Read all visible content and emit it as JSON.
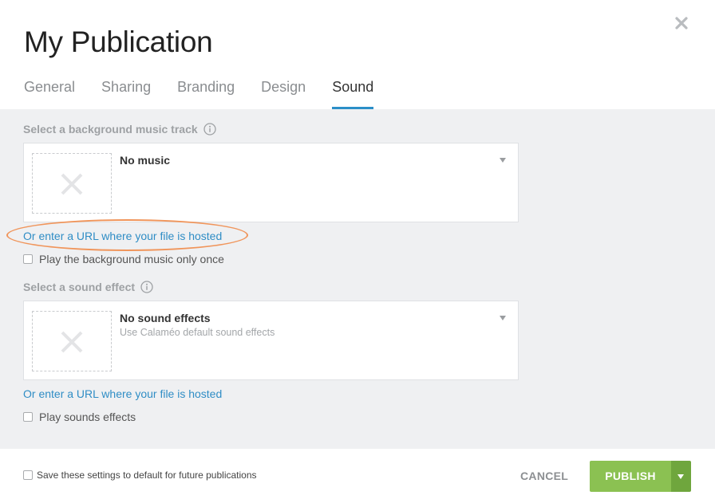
{
  "dialog": {
    "title": "My Publication",
    "close_icon": "close-icon"
  },
  "tabs": [
    {
      "label": "General",
      "active": false
    },
    {
      "label": "Sharing",
      "active": false
    },
    {
      "label": "Branding",
      "active": false
    },
    {
      "label": "Design",
      "active": false
    },
    {
      "label": "Sound",
      "active": true
    }
  ],
  "music": {
    "section_label": "Select a background music track",
    "selected_title": "No music",
    "selected_subtitle": "",
    "url_link": "Or enter a URL where your file is hosted",
    "play_once_label": "Play the background music only once",
    "play_once_checked": false
  },
  "sound_effect": {
    "section_label": "Select a sound effect",
    "selected_title": "No sound effects",
    "selected_subtitle": "Use Calaméo default sound effects",
    "url_link": "Or enter a URL where your file is hosted",
    "play_label": "Play sounds effects",
    "play_checked": false
  },
  "footer": {
    "save_default_label": "Save these settings to default for future publications",
    "save_default_checked": false,
    "cancel_label": "CANCEL",
    "publish_label": "PUBLISH"
  },
  "colors": {
    "accent_blue": "#2b8fc8",
    "publish_green": "#8bc152",
    "publish_dropdown_green": "#6fa63d",
    "annotation_orange": "#f0955b",
    "panel_gray": "#eff0f2"
  }
}
